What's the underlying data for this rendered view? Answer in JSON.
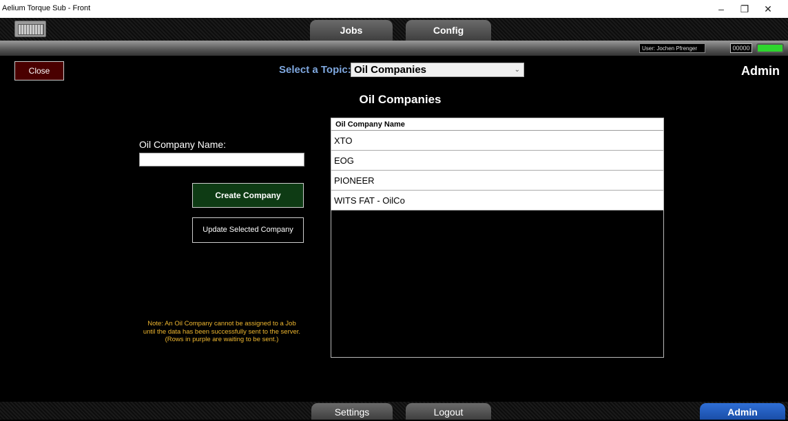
{
  "window": {
    "title": "Aelium Torque Sub - Front",
    "minimize_glyph": "–",
    "restore_glyph": "❐",
    "close_glyph": "✕"
  },
  "nav": {
    "tabs": [
      "Jobs",
      "Config"
    ]
  },
  "status": {
    "user": "User: Jochen Pfrenger",
    "counter": "00000",
    "connection_color": "#2ed62e"
  },
  "header": {
    "close_label": "Close",
    "topic_label": "Select a Topic:",
    "topic_value": "Oil Companies",
    "role_label": "Admin"
  },
  "page": {
    "heading": "Oil Companies"
  },
  "form": {
    "name_label": "Oil Company Name:",
    "name_value": "",
    "create_label": "Create Company",
    "update_label": "Update Selected Company",
    "note_lines": [
      "Note: An Oil Company cannot be assigned to a Job",
      "until the data has been successfully sent to the server.",
      "(Rows in purple are waiting to be sent.)"
    ]
  },
  "table": {
    "column": "Oil Company Name",
    "rows": [
      "XTO",
      "EOG",
      "PIONEER",
      "WITS FAT - OilCo"
    ]
  },
  "bottom_nav": {
    "tabs": [
      "Settings",
      "Logout"
    ],
    "active_tab": "Admin"
  },
  "colors": {
    "topic_label": "#7fa8e0",
    "note_text": "#f0b830",
    "close_button": "#4a0000",
    "create_button": "#0e3b14",
    "admin_tab": "#1a4ea8"
  },
  "icons": {
    "keyboard": "keyboard-icon",
    "dropdown": "chevron-down-icon"
  }
}
